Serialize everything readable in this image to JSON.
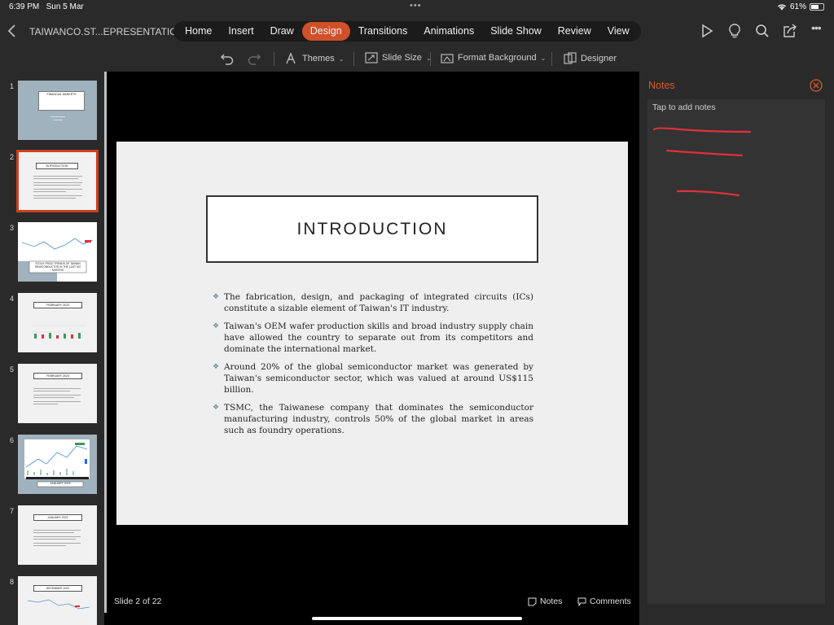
{
  "status": {
    "time": "6:39 PM",
    "date": "Sun 5 Mar",
    "battery": "61%",
    "battery_level": 0.61
  },
  "topbar": {
    "doc_name": "TAIWANCO.ST...EPRESENTATION",
    "tabs": [
      {
        "label": "Home"
      },
      {
        "label": "Insert"
      },
      {
        "label": "Draw"
      },
      {
        "label": "Design"
      },
      {
        "label": "Transitions"
      },
      {
        "label": "Animations"
      },
      {
        "label": "Slide Show"
      },
      {
        "label": "Review"
      },
      {
        "label": "View"
      }
    ],
    "active_tab": "Design"
  },
  "ribbon": {
    "themes": "Themes",
    "slide_size": "Slide Size",
    "format_background": "Format Background",
    "designer": "Designer"
  },
  "thumbnails": {
    "numbers": [
      "1",
      "2",
      "3",
      "4",
      "5",
      "6",
      "7",
      "8"
    ],
    "selected": "2",
    "titles": [
      "FINANCIAL MARKETS",
      "INTRODUCTION",
      "STOCK PRICE TRENDS OF TAIWAN SEMICONDUCTOR IN THE LAST SIX MONTHS",
      "FEBRUARY 2023",
      "FEBRUARY 2023",
      "JANUARY 2023",
      "JANUARY 2023",
      "DECEMBER 2022"
    ]
  },
  "slide": {
    "title": "INTRODUCTION",
    "bullets": [
      "The fabrication, design, and packaging of integrated circuits (ICs) constitute a sizable element of Taiwan's IT industry.",
      "Taiwan's OEM wafer production skills and broad industry supply chain have allowed the country to separate out from its competitors and dominate the international market.",
      "Around 20% of the global semiconductor market was generated by Taiwan's semiconductor sector, which was valued at around US$115 billion.",
      "TSMC, the Taiwanese company that dominates the semiconductor manufacturing industry, controls 50% of the global market in areas such as foundry operations."
    ]
  },
  "footer": {
    "slide_info": "Slide 2 of 22",
    "notes_button": "Notes",
    "comments_button": "Comments"
  },
  "notes": {
    "header": "Notes",
    "placeholder": "Tap to add notes",
    "ink_color": "#e0303a"
  },
  "colors": {
    "accent": "#d0502a",
    "selection": "#c9401e",
    "panel": "#2a2a2a"
  }
}
